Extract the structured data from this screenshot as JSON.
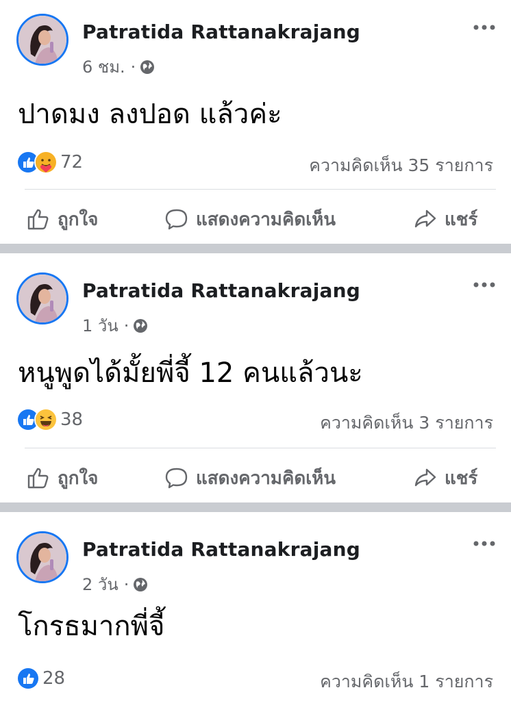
{
  "posts": [
    {
      "author": "Patratida Rattanakrajang",
      "time": "6 ชม.",
      "meta_separator": "·",
      "text": "ปาดมง ลงปอด แล้วค่ะ",
      "reaction_count": "72",
      "reactions": [
        "like",
        "care"
      ],
      "comments": "ความคิดเห็น 35 รายการ"
    },
    {
      "author": "Patratida Rattanakrajang",
      "time": "1 วัน",
      "meta_separator": "·",
      "text": "หนูพูดได้มั้ยพี่จี้ 12 คนแล้วนะ",
      "reaction_count": "38",
      "reactions": [
        "like",
        "haha"
      ],
      "comments": "ความคิดเห็น 3 รายการ"
    },
    {
      "author": "Patratida Rattanakrajang",
      "time": "2 วัน",
      "meta_separator": "·",
      "text": "โกรธมากพี่จี้",
      "reaction_count": "28",
      "reactions": [
        "like"
      ],
      "comments": "ความคิดเห็น 1 รายการ"
    }
  ],
  "actions": {
    "like": "ถูกใจ",
    "comment": "แสดงความคิดเห็น",
    "share": "แชร์"
  },
  "colors": {
    "brand_blue": "#1877f2",
    "secondary_text": "#65676b",
    "separator": "#c9ccd1",
    "care_yellow": "#f7b125",
    "haha_yellow": "#fcc33d"
  },
  "icons": [
    "globe-icon",
    "more-options-icon",
    "like-reaction-icon",
    "care-reaction-icon",
    "haha-reaction-icon",
    "thumbs-up-icon",
    "comment-bubble-icon",
    "share-arrow-icon"
  ]
}
